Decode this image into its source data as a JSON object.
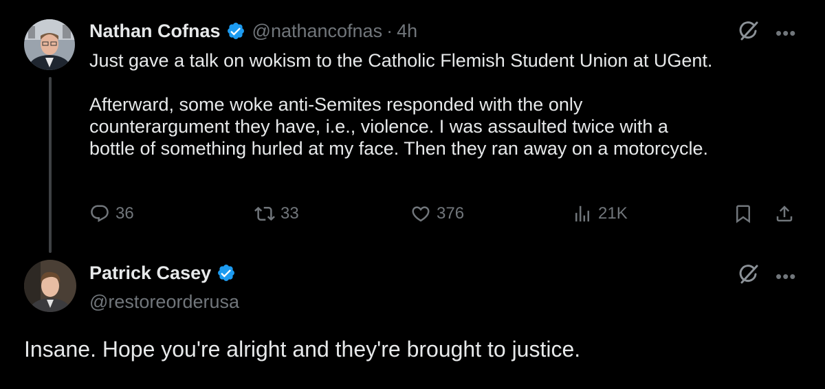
{
  "tweet1": {
    "author_name": "Nathan Cofnas",
    "author_handle": "@nathancofnas",
    "time": "4h",
    "paragraphs": [
      [
        "Just gave a talk on wokism to the Catholic Flemish Student Union at UGent."
      ],
      [
        "Afterward, some woke anti-Semites responded with the only",
        "counterargument they have, i.e., violence. I was assaulted twice with a",
        "bottle of something hurled at my face. Then they ran away on a motorcycle."
      ]
    ],
    "replies": "36",
    "reposts": "33",
    "likes": "376",
    "views": "21K"
  },
  "tweet2": {
    "author_name": "Patrick Casey",
    "author_handle": "@restoreorderusa",
    "text": "Insane. Hope you're alright and they're brought to justice."
  },
  "icons": {
    "verified": "verified-badge-icon",
    "grok": "grok-icon",
    "more": "more-icon",
    "reply": "reply-icon",
    "repost": "repost-icon",
    "like": "like-icon",
    "views": "views-icon",
    "bookmark": "bookmark-icon",
    "share": "share-icon"
  },
  "colors": {
    "background": "#000000",
    "text": "#e7e9ea",
    "secondary": "#71767b",
    "verified": "#1d9bf0",
    "thread_line": "#3e4144"
  }
}
